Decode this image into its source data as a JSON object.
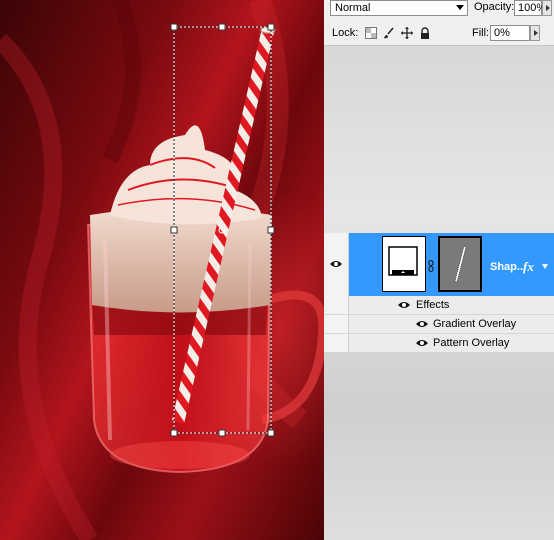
{
  "options_bar": {
    "blend_mode": "Normal",
    "opacity_label": "Opacity:",
    "opacity_value": "100%",
    "lock_label": "Lock:",
    "fill_label": "Fill:",
    "fill_value": "0%"
  },
  "layers": {
    "selected_layer": {
      "name": "Shap...",
      "fx_label": "fx"
    },
    "effects_label": "Effects",
    "effects": [
      {
        "label": "Gradient Overlay"
      },
      {
        "label": "Pattern Overlay"
      }
    ]
  },
  "icons": {
    "visibility": "eye-icon",
    "lock_transparent": "checker-icon",
    "lock_image": "brush-icon",
    "lock_position": "move-icon",
    "lock_all": "lock-icon",
    "link": "chain-link-icon",
    "layer_effects": "fx-icon"
  },
  "colors": {
    "selection_blue": "#3399ff",
    "canvas_red": "#8c0c12",
    "stripe_red": "#e01822"
  }
}
